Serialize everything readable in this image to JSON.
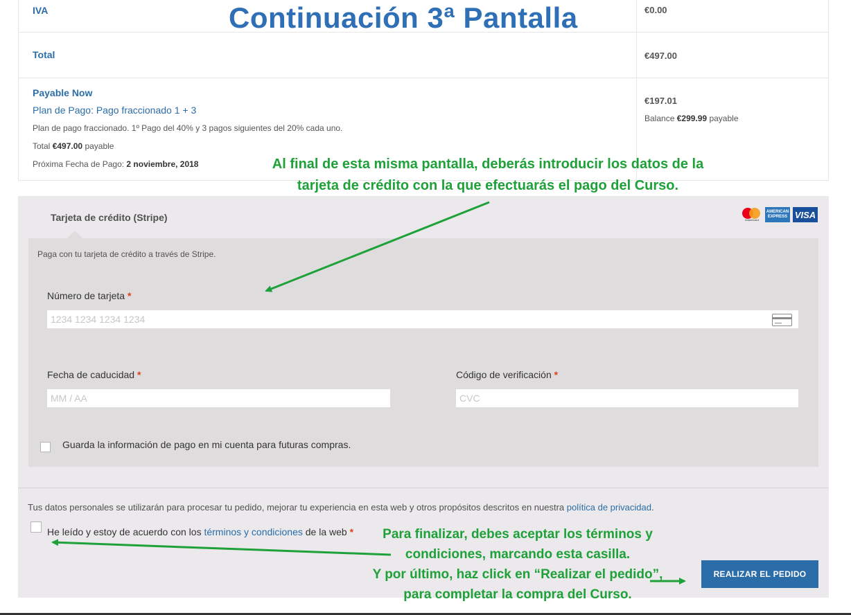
{
  "summary": {
    "iva_label": "IVA",
    "iva_value": "€0.00",
    "total_label": "Total",
    "total_value": "€497.00",
    "payable_now_label": "Payable Now",
    "plan_link": "Plan de Pago: Pago fraccionado 1 + 3",
    "plan_desc": "Plan de pago fraccionado. 1º Pago del 40% y 3 pagos siguientes del 20% cada uno.",
    "total_payable_prefix": "Total",
    "total_payable_amount": "€497.00",
    "total_payable_suffix": "payable",
    "next_date_prefix": "Próxima Fecha de Pago:",
    "next_date_value": "2 noviembre, 2018",
    "payable_now_value": "€197.01",
    "balance_prefix": "Balance",
    "balance_amount": "€299.99",
    "balance_suffix": "payable"
  },
  "annotations": {
    "title": "Continuación 3ª Pantalla",
    "card_note_line1": "Al final de esta misma pantalla, deberás introducir los datos de la",
    "card_note_line2": "tarjeta de crédito con la que efectuarás el pago del Curso.",
    "terms_note_line1": "Para finalizar, debes aceptar los términos y",
    "terms_note_line2": "condiciones, marcando esta casilla.",
    "terms_note_line3": "Y por último, haz click en “Realizar el pedido”,",
    "terms_note_line4": "para completar la compra del Curso.",
    "color": "#1ea139",
    "title_color": "#2f6fb5"
  },
  "payment": {
    "method_label": "Tarjeta de crédito (Stripe)",
    "card_brands": [
      "mastercard",
      "AMERICAN EXPRESS",
      "VISA"
    ],
    "mastercard_text": "mastercard",
    "amex_text": "AMERICAN EXPRESS",
    "visa_text": "VISA",
    "description": "Paga con tu tarjeta de crédito a través de Stripe.",
    "card_number_label": "Número de tarjeta",
    "card_number_placeholder": "1234 1234 1234 1234",
    "expiry_label": "Fecha de caducidad",
    "expiry_placeholder": "MM / AA",
    "cvc_label": "Código de verificación",
    "cvc_placeholder": "CVC",
    "required_mark": "*",
    "save_info_label": "Guarda la información de pago en mi cuenta para futuras compras.",
    "save_info_checked": false
  },
  "checkout": {
    "privacy_text": "Tus datos personales se utilizarán para procesar tu pedido, mejorar tu experiencia en esta web y otros propósitos descritos en nuestra",
    "privacy_link": "política de privacidad",
    "privacy_end": ".",
    "terms_prefix": "He leído y estoy de acuerdo con los",
    "terms_link": "términos y condiciones",
    "terms_suffix": "de la web",
    "terms_checked": false,
    "place_order_label": "Realizar el pedido",
    "accent_color": "#2b6da8"
  }
}
